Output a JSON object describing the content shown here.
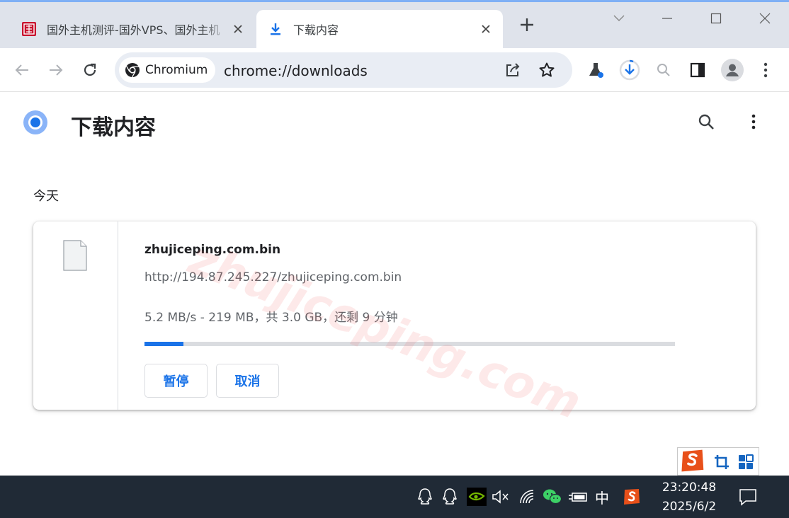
{
  "browser": {
    "tabs": [
      {
        "title": "国外主机测评-国外VPS、国外主机",
        "active": false
      },
      {
        "title": "下载内容",
        "active": true
      }
    ],
    "omnibox": {
      "chip_label": "Chromium",
      "url": "chrome://downloads"
    }
  },
  "page": {
    "title": "下载内容",
    "date_group": "今天",
    "download": {
      "filename": "zhujiceping.com.bin",
      "url": "http://194.87.245.227/zhujiceping.com.bin",
      "status": "5.2 MB/s - 219 MB，共 3.0 GB，还剩 9 分钟",
      "progress_fraction": 0.073,
      "pause_label": "暂停",
      "cancel_label": "取消"
    },
    "watermark": "zhujiceping.com"
  },
  "taskbar": {
    "ime_mode": "中",
    "time": "23:20:48",
    "date": "2025/6/2"
  },
  "colors": {
    "accent": "#1a73e8",
    "tabstrip": "#dfe3eb",
    "taskbar": "#202a36",
    "omnibox": "#e9edf4"
  },
  "icons": {
    "tab1": "site-seal-icon",
    "tab2": "download-icon",
    "toolbar": [
      "back-icon",
      "forward-icon",
      "reload-icon",
      "share-icon",
      "bookmark-star-icon",
      "labs-flask-icon",
      "downloads-progress-icon",
      "zoom-icon",
      "side-panel-icon",
      "profile-avatar-icon",
      "menu-kebab-icon"
    ],
    "tray": [
      "qq-icon",
      "qq-icon",
      "nvidia-icon",
      "volume-muted-icon",
      "wifi-icon",
      "wechat-icon",
      "power-plug-icon",
      "sogou-icon",
      "notification-icon"
    ]
  }
}
